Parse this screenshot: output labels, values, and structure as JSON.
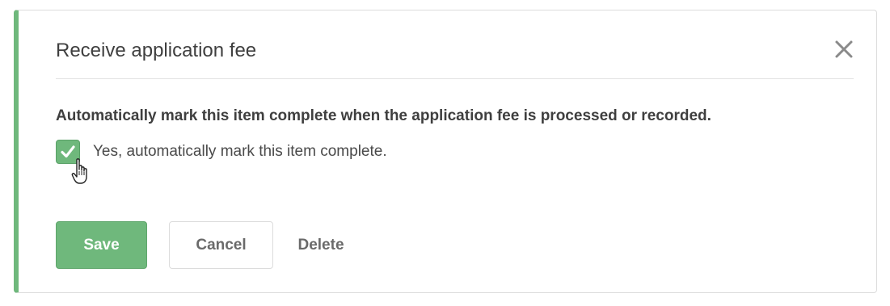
{
  "dialog": {
    "title": "Receive application fee",
    "description": "Automatically mark this item complete when the application fee is processed or recorded.",
    "checkbox": {
      "label": "Yes, automatically mark this item complete.",
      "checked": true
    },
    "buttons": {
      "save": "Save",
      "cancel": "Cancel",
      "delete": "Delete"
    },
    "icons": {
      "close": "close-icon",
      "check": "checkmark-icon",
      "cursor": "hand-pointer-cursor-icon"
    },
    "colors": {
      "accent": "#6fb87c",
      "text": "#3f3f3f",
      "muted": "#6a6a6a",
      "border": "#dcdcdc"
    }
  }
}
